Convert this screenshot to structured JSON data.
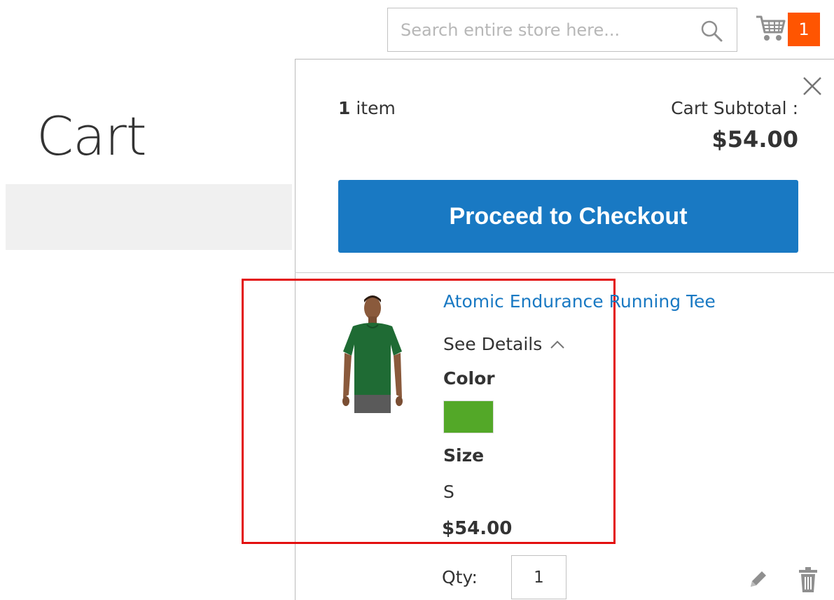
{
  "header": {
    "search": {
      "placeholder": "Search entire store here...",
      "value": ""
    },
    "cart": {
      "count": "1"
    }
  },
  "main": {
    "page_title": "Cart"
  },
  "minicart": {
    "items_count": "1",
    "items_label": "item",
    "subtotal_label": "Cart Subtotal :",
    "subtotal_price": "$54.00",
    "checkout_label": "Proceed to Checkout",
    "item": {
      "name": "Atomic Endurance Running Tee",
      "see_details": "See Details",
      "options": {
        "color_label": "Color",
        "color_value_hex": "#53a828",
        "size_label": "Size",
        "size_value": "S"
      },
      "price": "$54.00",
      "qty_label": "Qty:",
      "qty_value": "1"
    }
  },
  "colors": {
    "accent": "#1979c3",
    "cart_badge": "#ff5501",
    "highlight": "#e30f0f"
  }
}
